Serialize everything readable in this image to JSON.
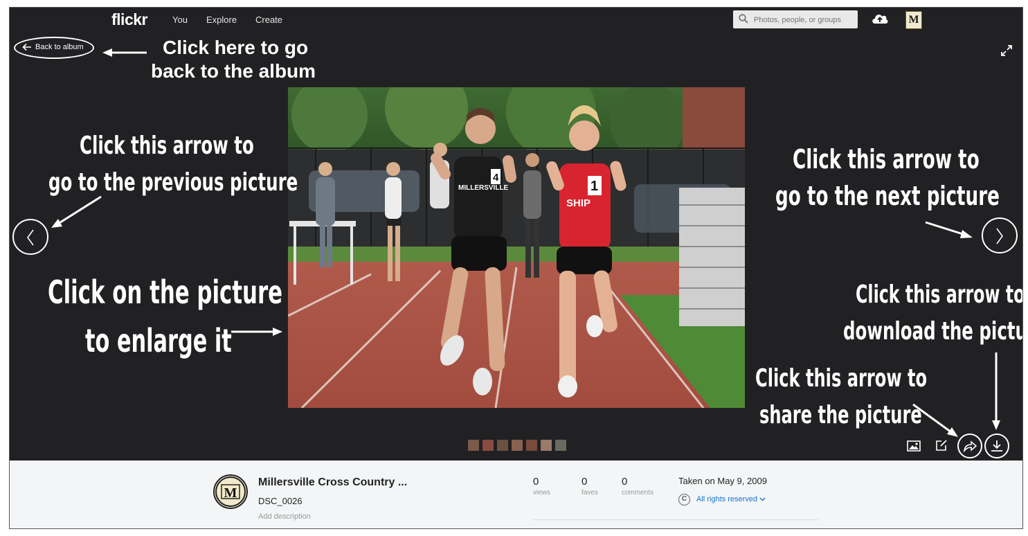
{
  "topbar": {
    "logo": "flickr",
    "nav": [
      "You",
      "Explore",
      "Create"
    ],
    "search_placeholder": "Photos, people, or groups",
    "icons": [
      "search-icon",
      "upload-cloud-icon",
      "user-avatar"
    ]
  },
  "viewer": {
    "back_label": "Back to album",
    "filmstrip_count": 7,
    "tools": [
      "photo-size-icon",
      "edit-icon",
      "share-icon",
      "download-icon"
    ]
  },
  "annotations": {
    "back_line1": "Click here to go",
    "back_line2": "back to the album",
    "prev_line1": "Click this arrow to",
    "prev_line2": "go to the previous picture",
    "next_line1": "Click this arrow to",
    "next_line2": "go to the next picture",
    "enlarge_line1": "Click on the picture",
    "enlarge_line2": "to enlarge it",
    "download_line1": "Click this arrow to",
    "download_line2": "download the picture",
    "share_line1": "Click this arrow to",
    "share_line2": "share the picture"
  },
  "photo": {
    "bib_left": "4",
    "bib_right": "1",
    "jersey_left": "MILLERSVILLE",
    "jersey_right": "SHIP"
  },
  "info": {
    "owner": "Millersville Cross Country ...",
    "title": "DSC_0026",
    "description_placeholder": "Add description",
    "stats": [
      {
        "value": "0",
        "label": "views"
      },
      {
        "value": "0",
        "label": "faves"
      },
      {
        "value": "0",
        "label": "comments"
      }
    ],
    "taken": "Taken on May 9, 2009",
    "license": "All rights reserved",
    "logo_letter": "M"
  },
  "colors": {
    "dark_bg": "#212124",
    "info_bg": "#f3f5f6",
    "link": "#1a75cf"
  }
}
